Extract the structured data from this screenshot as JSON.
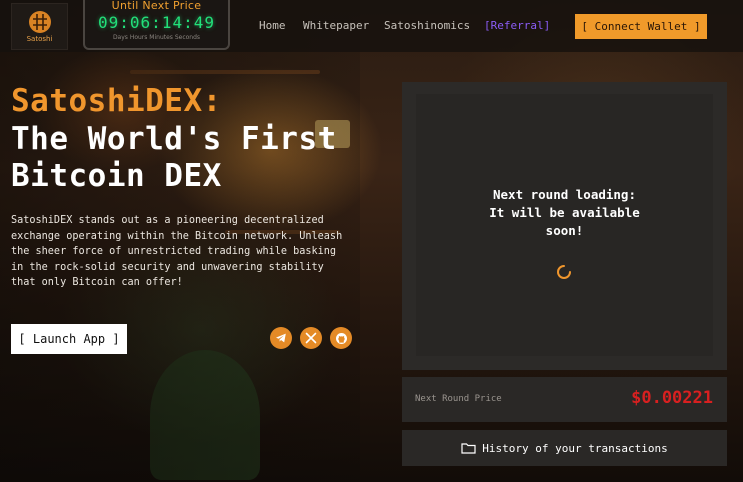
{
  "brand": {
    "logo_text": "Satoshi"
  },
  "countdown": {
    "title": "Until Next Price",
    "digits": "09:06:14:49",
    "units": "Days Hours Minutes Seconds"
  },
  "nav": {
    "items": [
      {
        "label": "Home"
      },
      {
        "label": "Whitepaper"
      },
      {
        "label": "Satoshinomics"
      },
      {
        "label": "[Referral]"
      }
    ],
    "connect_label": "[ Connect Wallet ]"
  },
  "hero": {
    "title_accent": "SatoshiDEX:",
    "title_line2": "The World's First",
    "title_line3": "Bitcoin DEX",
    "description": "SatoshiDEX stands out as a pioneering decentralized exchange operating within the Bitcoin network. Unleash the sheer force of unrestricted trading while basking in the rock-solid security and unwavering stability that only Bitcoin can offer!",
    "launch_label": "[ Launch App ]"
  },
  "socials": [
    {
      "icon": "telegram-icon"
    },
    {
      "icon": "x-icon"
    },
    {
      "icon": "github-icon"
    }
  ],
  "panel": {
    "loading_line1": "Next round loading:",
    "loading_line2": "It will be available",
    "loading_line3": "soon!"
  },
  "price": {
    "label": "Next Round Price",
    "value": "$0.00221"
  },
  "history": {
    "label": "History of your transactions"
  },
  "colors": {
    "accent": "#f0962d",
    "countdown_green": "#22e07a",
    "referral": "#8b5cf6",
    "price_red": "#d82020"
  }
}
